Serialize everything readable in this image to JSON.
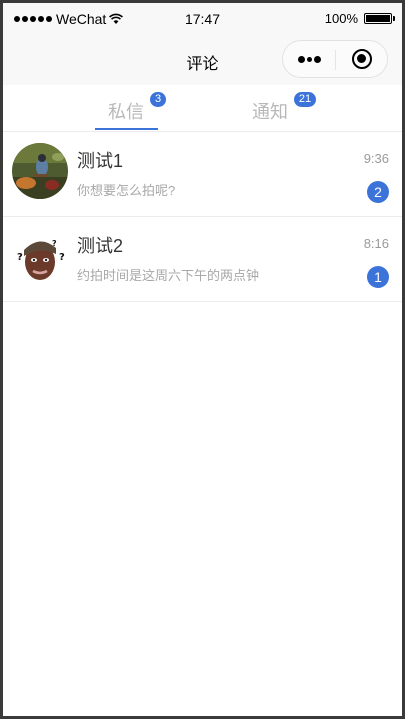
{
  "statusbar": {
    "carrier": "WeChat",
    "time": "17:47",
    "battery": "100%",
    "battery_level": 1.0
  },
  "navbar": {
    "title": "评论",
    "more_icon": "more-dots-icon",
    "close_icon": "target-circle-icon"
  },
  "tabs": [
    {
      "label": "私信",
      "badge": "3",
      "active": true
    },
    {
      "label": "通知",
      "badge": "21",
      "active": false
    }
  ],
  "messages": [
    {
      "name": "测试1",
      "time": "9:36",
      "preview": "你想要怎么拍呢?",
      "unread": "2",
      "avatar": "bird-photo"
    },
    {
      "name": "测试2",
      "time": "8:16",
      "preview": "约拍时间是这周六下午的两点钟",
      "unread": "1",
      "avatar": "confused-man-photo"
    }
  ],
  "colors": {
    "accent": "#3b73d9",
    "tab_inactive": "#b8b8b8",
    "muted_text": "#a8a8a8"
  }
}
